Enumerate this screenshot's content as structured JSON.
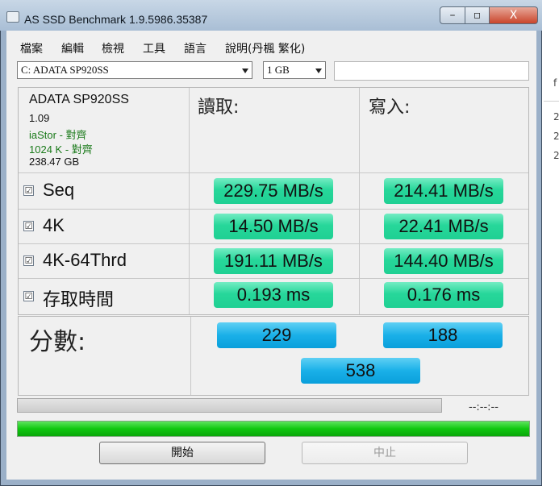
{
  "window": {
    "title": "AS SSD Benchmark 1.9.5986.35387",
    "min_glyph": "–",
    "max_glyph": "▫",
    "close_glyph": "X"
  },
  "menu": [
    "檔案",
    "編輯",
    "檢視",
    "工具",
    "語言",
    "說明(丹楓 繁化)"
  ],
  "toolbar": {
    "drive": "C: ADATA SP920SS",
    "size": "1 GB",
    "text_value": ""
  },
  "info": {
    "model": "ADATA SP920SS",
    "firmware": "1.09",
    "driver": "iaStor - 對齊",
    "alignment": "1024 K - 對齊",
    "capacity": "238.47 GB"
  },
  "headers": {
    "read": "讀取:",
    "write": "寫入:"
  },
  "tests": [
    {
      "name": "Seq",
      "checked": "☑",
      "read": "229.75 MB/s",
      "write": "214.41 MB/s"
    },
    {
      "name": "4K",
      "checked": "☑",
      "read": "14.50 MB/s",
      "write": "22.41 MB/s"
    },
    {
      "name": "4K-64Thrd",
      "checked": "☑",
      "read": "191.11 MB/s",
      "write": "144.40 MB/s"
    },
    {
      "name": "存取時間",
      "checked": "☑",
      "read": "0.193 ms",
      "write": "0.176 ms"
    }
  ],
  "score": {
    "label": "分數:",
    "read": "229",
    "write": "188",
    "total": "538"
  },
  "progress": {
    "time": "--:--:--",
    "fill_fraction": 1.0
  },
  "buttons": {
    "start": "開始",
    "stop": "中止"
  },
  "colors": {
    "result_green": "#27d79a",
    "score_blue": "#1ab0e8",
    "progress_green": "#10c810",
    "info_green": "#1a7a1a"
  }
}
